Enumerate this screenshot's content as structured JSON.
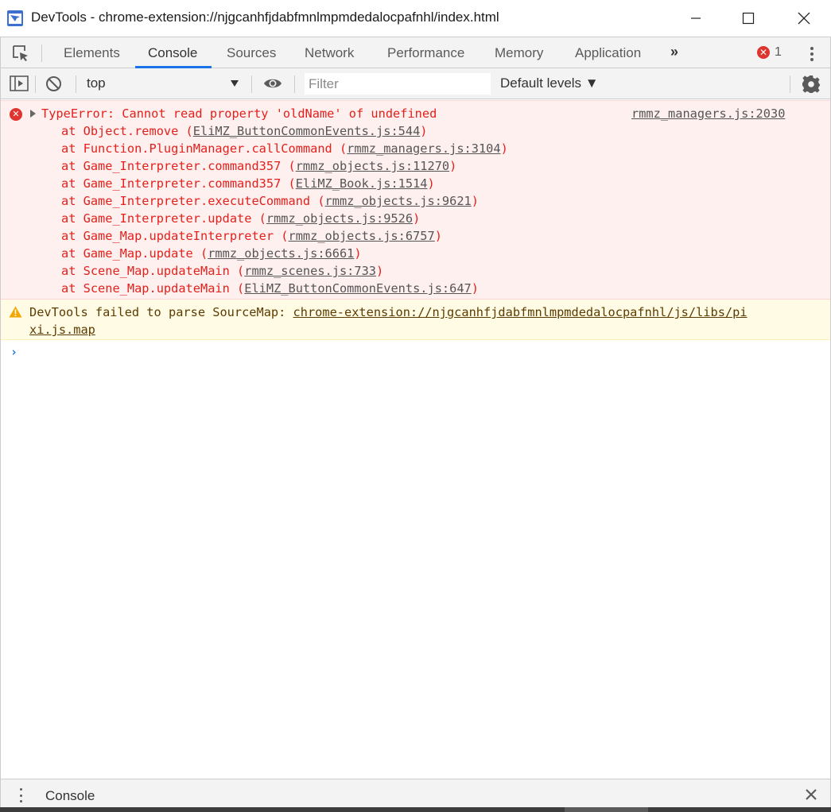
{
  "window": {
    "title": "DevTools - chrome-extension://njgcanhfjdabfmnlmpmdedalocpafnhl/index.html",
    "minimize_glyph": "—",
    "maximize_glyph": "☐",
    "close_glyph": "✕"
  },
  "tabs": [
    {
      "label": "Elements",
      "active": false
    },
    {
      "label": "Console",
      "active": true
    },
    {
      "label": "Sources",
      "active": false
    },
    {
      "label": "Network",
      "active": false
    },
    {
      "label": "Performance",
      "active": false
    },
    {
      "label": "Memory",
      "active": false
    },
    {
      "label": "Application",
      "active": false
    }
  ],
  "more_tabs_glyph": "»",
  "error_badge": {
    "count": "1",
    "icon": "error-icon",
    "color": "#e0342f"
  },
  "console_toolbar": {
    "context": "top",
    "filter_placeholder": "Filter",
    "levels": "Default levels ▼"
  },
  "error_message": {
    "text": "TypeError: Cannot read property 'oldName' of undefined",
    "source": "rmmz_managers.js:2030",
    "stack": [
      {
        "prefix": "at Object.remove (",
        "link": "EliMZ_ButtonCommonEvents.js:544",
        "suffix": ")"
      },
      {
        "prefix": "at Function.PluginManager.callCommand (",
        "link": "rmmz_managers.js:3104",
        "suffix": ")"
      },
      {
        "prefix": "at Game_Interpreter.command357 (",
        "link": "rmmz_objects.js:11270",
        "suffix": ")"
      },
      {
        "prefix": "at Game_Interpreter.command357 (",
        "link": "EliMZ_Book.js:1514",
        "suffix": ")"
      },
      {
        "prefix": "at Game_Interpreter.executeCommand (",
        "link": "rmmz_objects.js:9621",
        "suffix": ")"
      },
      {
        "prefix": "at Game_Interpreter.update (",
        "link": "rmmz_objects.js:9526",
        "suffix": ")"
      },
      {
        "prefix": "at Game_Map.updateInterpreter (",
        "link": "rmmz_objects.js:6757",
        "suffix": ")"
      },
      {
        "prefix": "at Game_Map.update (",
        "link": "rmmz_objects.js:6661",
        "suffix": ")"
      },
      {
        "prefix": "at Scene_Map.updateMain (",
        "link": "rmmz_scenes.js:733",
        "suffix": ")"
      },
      {
        "prefix": "at Scene_Map.updateMain (",
        "link": "EliMZ_ButtonCommonEvents.js:647",
        "suffix": ")"
      }
    ]
  },
  "warning_message": {
    "prefix": "DevTools failed to parse SourceMap: ",
    "link_line1": "chrome-extension://njgcanhfjdabfmnlmpmdedalocpafnhl/js/libs/pi",
    "link_line2": "xi.js.map"
  },
  "prompt_glyph": "›",
  "drawer": {
    "tab_label": "Console"
  },
  "colors": {
    "error_text": "#e3211c",
    "error_bg": "#fff0f0",
    "warning_bg": "#fffbe5",
    "warning_text": "#5c3b00",
    "accent": "#1a73e8"
  }
}
